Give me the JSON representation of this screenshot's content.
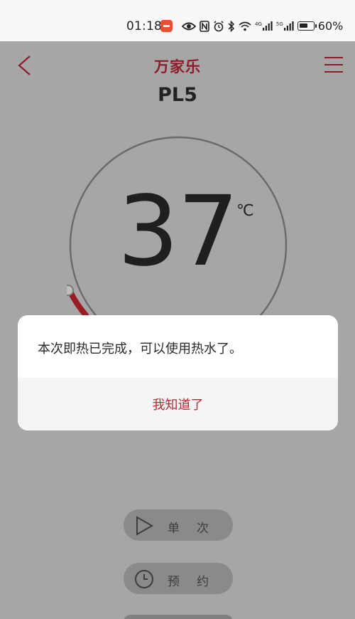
{
  "status_bar": {
    "time": "01:18",
    "network_labels": [
      "4G",
      "5G"
    ],
    "battery": "60%"
  },
  "header": {
    "brand": "万家乐",
    "device_name": "PL5"
  },
  "dial": {
    "temperature": "37",
    "unit": "℃"
  },
  "dialog": {
    "message": "本次即热已完成，可以使用热水了。",
    "action_label": "我知道了"
  },
  "modes": [
    {
      "label": "单次",
      "icon": "play-icon"
    },
    {
      "label": "预约",
      "icon": "clock-icon"
    }
  ],
  "colors": {
    "brand": "#8a1f2c",
    "accent": "#c0202e",
    "dialog_action": "#b52b33",
    "overlay_background": "#a6a6a6"
  }
}
